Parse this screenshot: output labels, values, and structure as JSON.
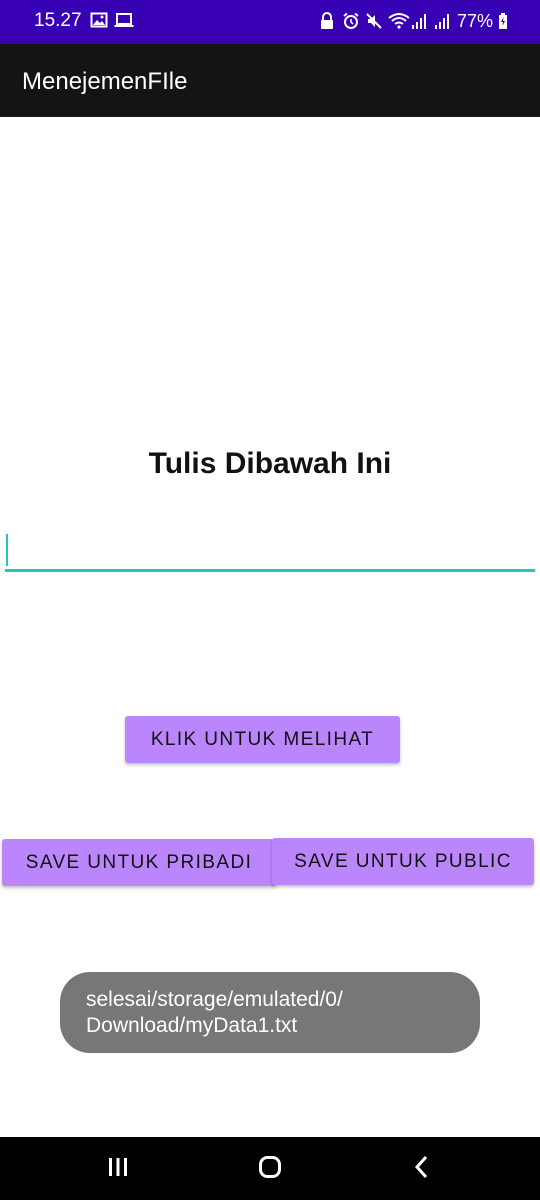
{
  "status_bar": {
    "time": "15.27",
    "battery": "77%",
    "left_icons": [
      "image-icon",
      "laptop-icon"
    ],
    "right_icons": [
      "lock-icon",
      "alarm-icon",
      "mute-icon",
      "wifi-icon",
      "signal-icon",
      "signal-icon",
      "battery-icon"
    ],
    "background": "#3700b3"
  },
  "app_bar": {
    "title": "MenejemenFIle",
    "background": "#141414"
  },
  "main": {
    "heading": "Tulis Dibawah Ini",
    "input": {
      "value": "",
      "placeholder": "",
      "underline_color": "#26c6b6"
    },
    "buttons": {
      "view_label": "KLIK UNTUK MELIHAT",
      "save_private_label": "SAVE UNTUK PRIBADI",
      "save_public_label": "SAVE UNTUK PUBLIC",
      "color": "#bb86fc"
    }
  },
  "toast": {
    "line1": "selesai/storage/emulated/0/",
    "line2": "Download/myData1.txt"
  },
  "nav_bar": {
    "icons": [
      "recents-icon",
      "home-icon",
      "back-icon"
    ]
  }
}
